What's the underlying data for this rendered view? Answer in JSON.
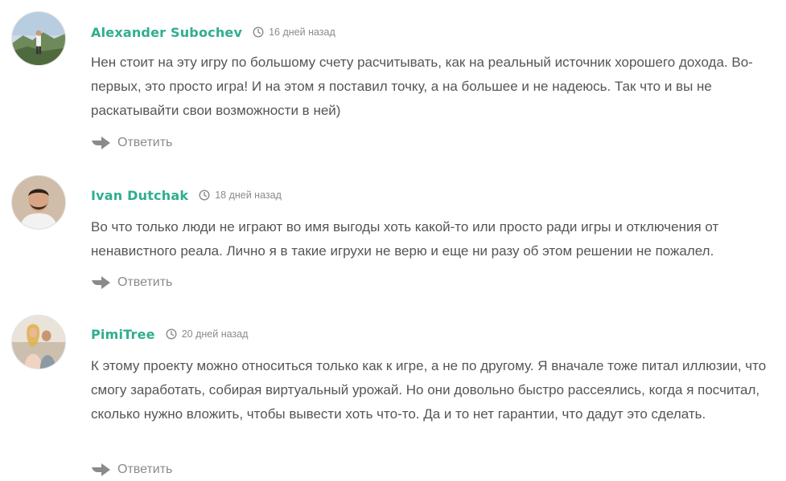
{
  "comments": [
    {
      "author": "Alexander Subochev",
      "date": "16 дней назад",
      "text": "Нен стоит на эту игру по большому счету расчитывать, как на реальный источник хорошего дохода. Во-первых, это просто игра! И на этом я поставил точку, а на большее и не надеюсь. Так что и вы не раскатывайти свои возможности в ней)",
      "reply_label": "Ответить"
    },
    {
      "author": "Ivan Dutchak",
      "date": "18 дней назад",
      "text": "Во что только люди не играют во имя выгоды хоть какой-то или просто ради игры и отключения от ненавистного реала. Лично я в такие игрухи не верю и еще ни разу об этом решении не пожалел.",
      "reply_label": "Ответить"
    },
    {
      "author": "PimiTree",
      "date": "20 дней назад",
      "text": "К этому проекту можно относиться только как к игре, а не по другому. Я вначале тоже питал иллюзии, что смогу заработать, собирая виртуальный урожай. Но они довольно быстро рассеялись, когда я посчитал, сколько нужно вложить, чтобы вывести хоть что-то. Да и то нет гарантии, что дадут это сделать.",
      "reply_label": "Ответить"
    }
  ],
  "colors": {
    "author": "#2fae8f",
    "text": "#555555",
    "meta": "#8b8b8b"
  },
  "icons": {
    "date": "clock-icon",
    "reply": "reply-arrow-icon"
  }
}
